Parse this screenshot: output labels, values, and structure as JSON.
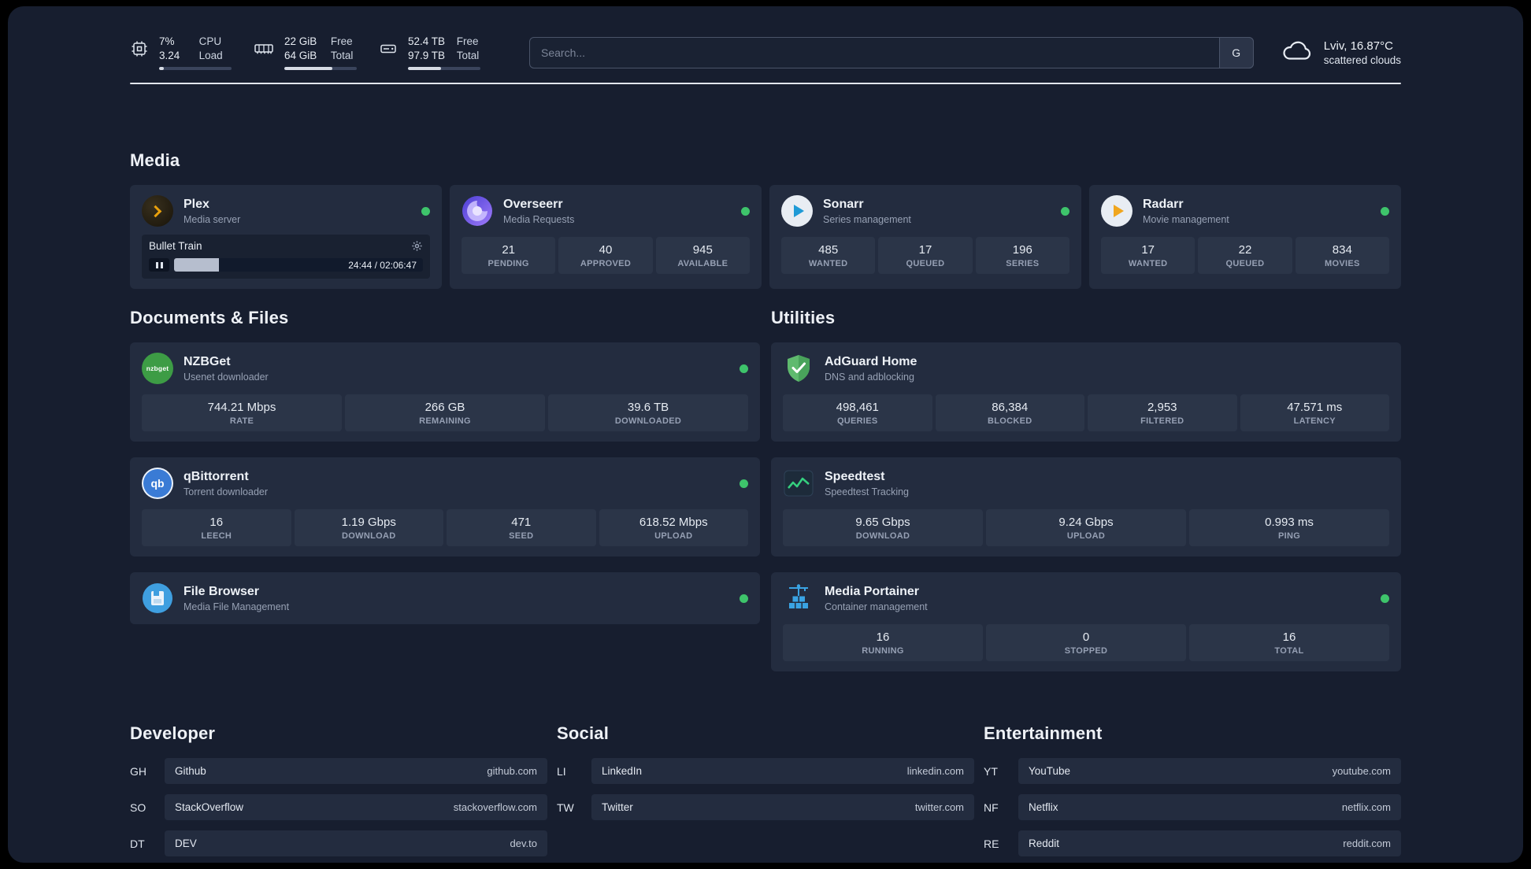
{
  "topbar": {
    "cpu": {
      "icon": "chip-icon",
      "value_top": "7%",
      "value_bottom": "3.24",
      "label_top": "CPU",
      "label_bottom": "Load"
    },
    "ram": {
      "icon": "ram-icon",
      "value_top": "22 GiB",
      "value_bottom": "64 GiB",
      "label_top": "Free",
      "label_bottom": "Total"
    },
    "disk": {
      "icon": "disk-icon",
      "value_top": "52.4 TB",
      "value_bottom": "97.9 TB",
      "label_top": "Free",
      "label_bottom": "Total"
    },
    "search": {
      "placeholder": "Search...",
      "engine_button": "G"
    },
    "weather": {
      "icon": "cloud-icon",
      "location": "Lviv, 16.87°C",
      "condition": "scattered clouds"
    }
  },
  "section_titles": {
    "media": "Media",
    "documents": "Documents & Files",
    "utilities": "Utilities",
    "developer": "Developer",
    "social": "Social",
    "entertainment": "Entertainment"
  },
  "apps": {
    "plex": {
      "name": "Plex",
      "subtitle": "Media server",
      "now_playing": "Bullet Train",
      "time": "24:44 / 02:06:47"
    },
    "overseerr": {
      "name": "Overseerr",
      "subtitle": "Media Requests",
      "stats": [
        {
          "value": "21",
          "label": "PENDING"
        },
        {
          "value": "40",
          "label": "APPROVED"
        },
        {
          "value": "945",
          "label": "AVAILABLE"
        }
      ]
    },
    "sonarr": {
      "name": "Sonarr",
      "subtitle": "Series management",
      "stats": [
        {
          "value": "485",
          "label": "WANTED"
        },
        {
          "value": "17",
          "label": "QUEUED"
        },
        {
          "value": "196",
          "label": "SERIES"
        }
      ]
    },
    "radarr": {
      "name": "Radarr",
      "subtitle": "Movie management",
      "stats": [
        {
          "value": "17",
          "label": "WANTED"
        },
        {
          "value": "22",
          "label": "QUEUED"
        },
        {
          "value": "834",
          "label": "MOVIES"
        }
      ]
    },
    "nzbget": {
      "name": "NZBGet",
      "subtitle": "Usenet downloader",
      "icon_text": "nzbget",
      "stats": [
        {
          "value": "744.21 Mbps",
          "label": "RATE"
        },
        {
          "value": "266 GB",
          "label": "REMAINING"
        },
        {
          "value": "39.6 TB",
          "label": "DOWNLOADED"
        }
      ]
    },
    "qbittorrent": {
      "name": "qBittorrent",
      "subtitle": "Torrent downloader",
      "icon_text": "qb",
      "stats": [
        {
          "value": "16",
          "label": "LEECH"
        },
        {
          "value": "1.19 Gbps",
          "label": "DOWNLOAD"
        },
        {
          "value": "471",
          "label": "SEED"
        },
        {
          "value": "618.52 Mbps",
          "label": "UPLOAD"
        }
      ]
    },
    "filebrowser": {
      "name": "File Browser",
      "subtitle": "Media File Management"
    },
    "adguard": {
      "name": "AdGuard Home",
      "subtitle": "DNS and adblocking",
      "stats": [
        {
          "value": "498,461",
          "label": "QUERIES"
        },
        {
          "value": "86,384",
          "label": "BLOCKED"
        },
        {
          "value": "2,953",
          "label": "FILTERED"
        },
        {
          "value": "47.571 ms",
          "label": "LATENCY"
        }
      ]
    },
    "speedtest": {
      "name": "Speedtest",
      "subtitle": "Speedtest Tracking",
      "stats": [
        {
          "value": "9.65 Gbps",
          "label": "DOWNLOAD"
        },
        {
          "value": "9.24 Gbps",
          "label": "UPLOAD"
        },
        {
          "value": "0.993 ms",
          "label": "PING"
        }
      ]
    },
    "portainer": {
      "name": "Media Portainer",
      "subtitle": "Container management",
      "stats": [
        {
          "value": "16",
          "label": "RUNNING"
        },
        {
          "value": "0",
          "label": "STOPPED"
        },
        {
          "value": "16",
          "label": "TOTAL"
        }
      ]
    }
  },
  "bookmarks": {
    "developer": [
      {
        "abbr": "GH",
        "name": "Github",
        "url": "github.com"
      },
      {
        "abbr": "SO",
        "name": "StackOverflow",
        "url": "stackoverflow.com"
      },
      {
        "abbr": "DT",
        "name": "DEV",
        "url": "dev.to"
      }
    ],
    "social": [
      {
        "abbr": "LI",
        "name": "LinkedIn",
        "url": "linkedin.com"
      },
      {
        "abbr": "TW",
        "name": "Twitter",
        "url": "twitter.com"
      }
    ],
    "entertainment": [
      {
        "abbr": "YT",
        "name": "YouTube",
        "url": "youtube.com"
      },
      {
        "abbr": "NF",
        "name": "Netflix",
        "url": "netflix.com"
      },
      {
        "abbr": "RE",
        "name": "Reddit",
        "url": "reddit.com"
      }
    ]
  },
  "colors": {
    "status_online": "#3ec46b",
    "accent_plex": "#e8a00c",
    "background": "#171e2f",
    "card": "#232c3f"
  }
}
